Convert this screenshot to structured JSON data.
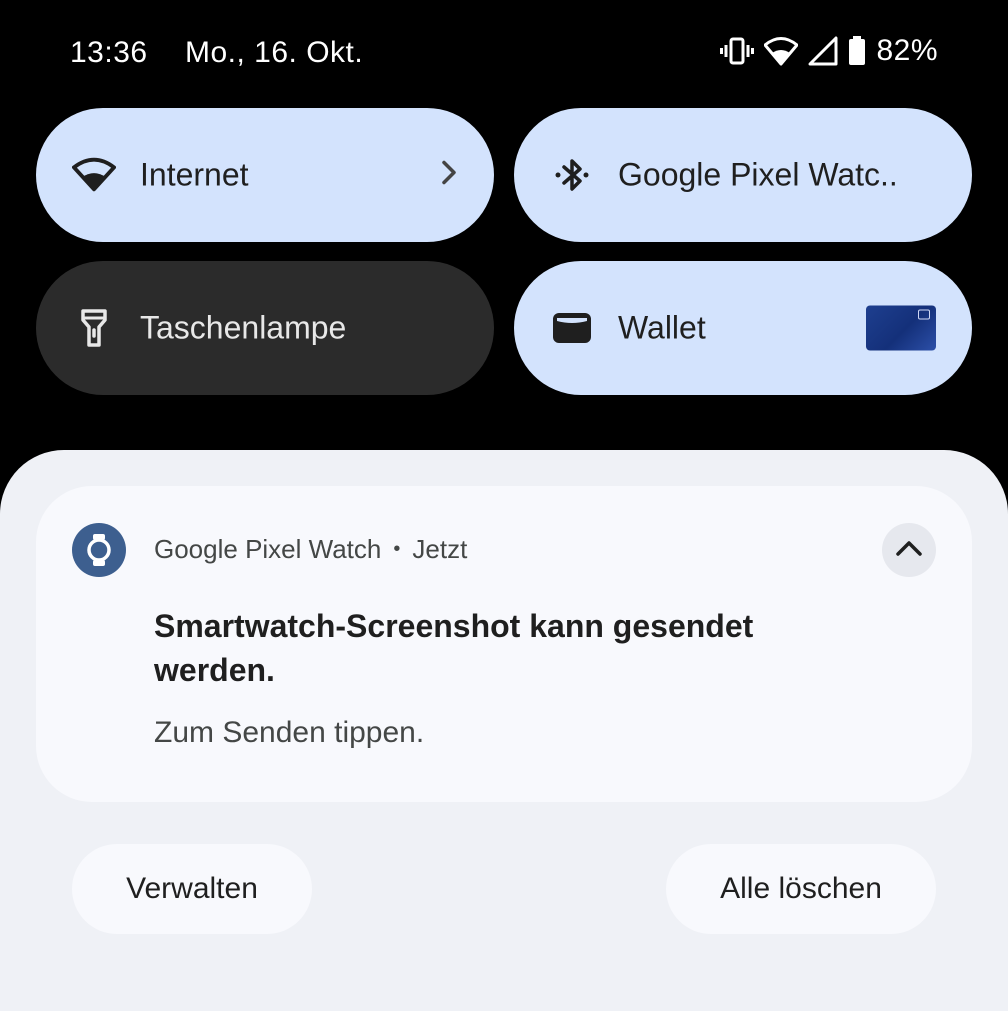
{
  "status_bar": {
    "time": "13:36",
    "date": "Mo., 16. Okt.",
    "battery_percent": "82%",
    "icons": [
      "vibrate-icon",
      "wifi-icon",
      "cell-signal-icon",
      "battery-icon"
    ]
  },
  "quick_settings": {
    "tiles": [
      {
        "label": "Internet",
        "icon": "wifi-icon",
        "state": "on",
        "has_chevron": true
      },
      {
        "label": "Google Pixel Watc..",
        "icon": "bluetooth-icon",
        "state": "on"
      },
      {
        "label": "Taschenlampe",
        "icon": "flashlight-icon",
        "state": "off"
      },
      {
        "label": "Wallet",
        "icon": "wallet-icon",
        "state": "on",
        "has_card_thumbnail": true
      }
    ]
  },
  "notification": {
    "app_name": "Google Pixel Watch",
    "separator": "•",
    "time": "Jetzt",
    "title": "Smartwatch-Screenshot kann gesendet werden.",
    "text": "Zum Senden tippen.",
    "app_icon": "watch-icon",
    "expanded": true
  },
  "footer": {
    "manage_label": "Verwalten",
    "clear_all_label": "Alle löschen"
  },
  "colors": {
    "tile_active": "#d3e3fd",
    "tile_inactive": "#2b2b2b",
    "shade_background": "#eff1f6",
    "notification_background": "#f8f9fd",
    "app_icon_background": "#3d5f8f"
  }
}
